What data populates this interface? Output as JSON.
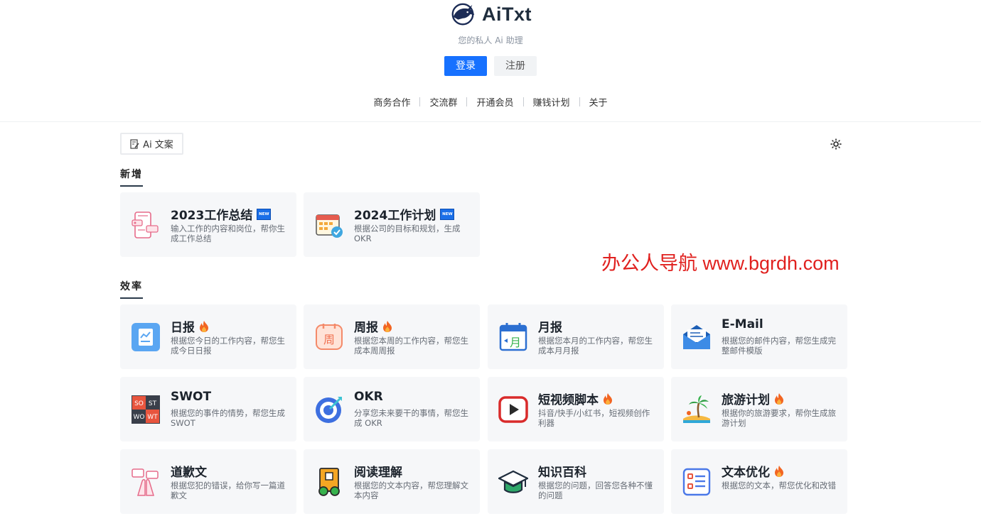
{
  "brand": {
    "name": "AiTxt",
    "subtitle": "您的私人 Ai 助理"
  },
  "auth": {
    "login": "登录",
    "register": "注册"
  },
  "nav": [
    "商务合作",
    "交流群",
    "开通会员",
    "赚钱计划",
    "关于"
  ],
  "category_tag": "Ai 文案",
  "sections": {
    "new": {
      "title": "新增",
      "cards": [
        {
          "title": "2023工作总结",
          "badge": "NEW",
          "desc": "输入工作的内容和岗位，帮你生成工作总结",
          "icon": "clipboard-phone-icon"
        },
        {
          "title": "2024工作计划",
          "badge": "NEW",
          "desc": "根据公司的目标和规划，生成OKR",
          "icon": "calendar-check-icon"
        }
      ]
    },
    "efficiency": {
      "title": "效率",
      "cards": [
        {
          "title": "日报",
          "hot": true,
          "desc": "根据您今日的工作内容，帮您生成今日日报",
          "icon": "daily-report-icon"
        },
        {
          "title": "周报",
          "hot": true,
          "desc": "根据您本周的工作内容，帮您生成本周周报",
          "icon": "weekly-calendar-icon"
        },
        {
          "title": "月报",
          "hot": false,
          "desc": "根据您本月的工作内容，帮您生成本月月报",
          "icon": "monthly-calendar-icon"
        },
        {
          "title": "E-Mail",
          "hot": false,
          "desc": "根据您的邮件内容，帮您生成完整邮件模版",
          "icon": "email-icon"
        },
        {
          "title": "SWOT",
          "hot": false,
          "desc": "根据您的事件的情势，帮您生成 SWOT",
          "icon": "swot-icon"
        },
        {
          "title": "OKR",
          "hot": false,
          "desc": "分享您未来要干的事情，帮您生成 OKR",
          "icon": "target-icon"
        },
        {
          "title": "短视频脚本",
          "hot": true,
          "desc": "抖音/快手/小红书，短视频创作利器",
          "icon": "video-play-icon"
        },
        {
          "title": "旅游计划",
          "hot": true,
          "desc": "根据你的旅游要求，帮你生成旅游计划",
          "icon": "palm-island-icon"
        },
        {
          "title": "道歉文",
          "hot": false,
          "desc": "根据您犯的错误，给你写一篇道歉文",
          "icon": "apology-hands-icon"
        },
        {
          "title": "阅读理解",
          "hot": false,
          "desc": "根据您的文本内容，帮您理解文本内容",
          "icon": "reading-book-icon"
        },
        {
          "title": "知识百科",
          "hot": false,
          "desc": "根据您的问题，回答您各种不懂的问题",
          "icon": "graduation-cap-icon"
        },
        {
          "title": "文本优化",
          "hot": true,
          "desc": "根据您的文本，帮您优化和改错",
          "icon": "text-list-icon"
        }
      ]
    }
  },
  "watermark": "办公人导航 www.bgrdh.com",
  "colors": {
    "primary": "#1771ff",
    "card_bg": "#f6f7f9",
    "watermark": "#e0201e"
  }
}
